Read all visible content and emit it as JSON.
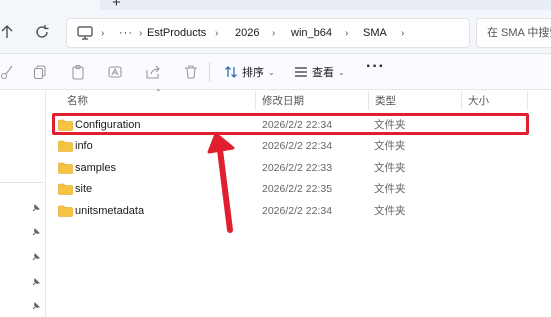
{
  "window": {
    "new_tab_glyph": "+"
  },
  "address_bar": {
    "overflow_glyph": "···",
    "crumbs": [
      "EstProducts",
      "2026",
      "win_b64",
      "SMA"
    ],
    "search_placeholder": "在 SMA 中搜索"
  },
  "toolbar": {
    "sort_label": "排序",
    "view_label": "查看",
    "more_glyph": "···"
  },
  "columns": {
    "name": "名称",
    "modified": "修改日期",
    "type": "类型",
    "size": "大小"
  },
  "files": [
    {
      "name": "Configuration",
      "modified": "2026/2/2 22:34",
      "type": "文件夹"
    },
    {
      "name": "info",
      "modified": "2026/2/2 22:34",
      "type": "文件夹"
    },
    {
      "name": "samples",
      "modified": "2026/2/2 22:33",
      "type": "文件夹"
    },
    {
      "name": "site",
      "modified": "2026/2/2 22:35",
      "type": "文件夹"
    },
    {
      "name": "unitsmetadata",
      "modified": "2026/2/2 22:34",
      "type": "文件夹"
    }
  ],
  "annotation": {
    "highlight_color": "#e0202e",
    "highlighted_row": "Configuration"
  },
  "colors": {
    "folder": "#f5c242",
    "accent_red": "#e0202e"
  }
}
